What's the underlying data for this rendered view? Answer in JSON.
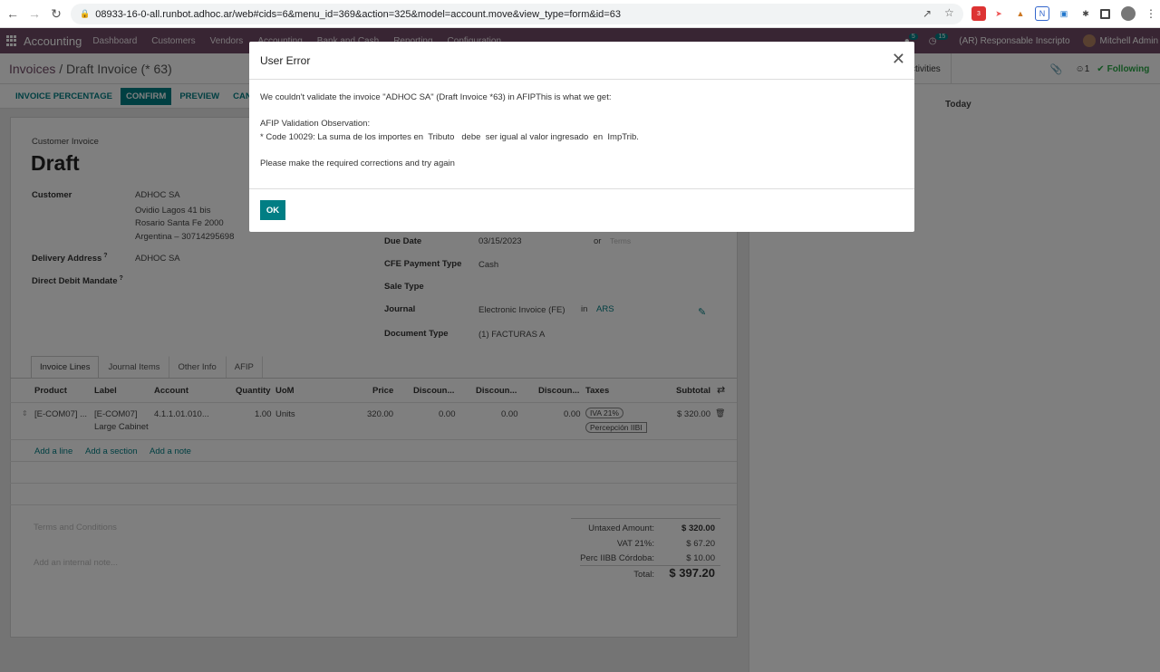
{
  "browser": {
    "url": "08933-16-0-all.runbot.adhoc.ar/web#cids=6&menu_id=369&action=325&model=account.move&view_type=form&id=63",
    "ext_badge": "3"
  },
  "topnav": {
    "app_name": "Accounting",
    "menus": [
      "Dashboard",
      "Customers",
      "Vendors",
      "Accounting",
      "Bank and Cash",
      "Reporting",
      "Configuration"
    ],
    "chat_count": "5",
    "activity_count": "15",
    "company": "(AR) Responsable Inscripto",
    "user": "Mitchell Admin"
  },
  "control": {
    "breadcrumb_parent": "Invoices",
    "breadcrumb_sep": "/",
    "breadcrumb_current": "Draft Invoice (* 63)",
    "activities_label": "ctivities",
    "followers_count": "1",
    "following_label": "Following"
  },
  "buttons": {
    "invoice_percentage": "INVOICE PERCENTAGE",
    "confirm": "CONFIRM",
    "preview": "PREVIEW",
    "cancel": "CANC"
  },
  "chatter": {
    "today": "Today"
  },
  "form": {
    "type_label": "Customer Invoice",
    "status": "Draft",
    "customer_label": "Customer",
    "customer_lines": [
      "ADHOC SA",
      "Ovidio Lagos 41 bis",
      "Rosario Santa Fe 2000",
      "Argentina – 30714295698"
    ],
    "delivery_label": "Delivery Address",
    "delivery_value": "ADHOC SA",
    "debit_label": "Direct Debit Mandate",
    "help_mark": "?",
    "due_date_label": "Due Date",
    "due_date_value": "03/15/2023",
    "or_label": "or",
    "terms_placeholder": "Terms",
    "cfe_label": "CFE Payment Type",
    "cfe_value": "Cash",
    "sale_type_label": "Sale Type",
    "journal_label": "Journal",
    "journal_value": "Electronic Invoice (FE)",
    "in_label": "in",
    "currency": "ARS",
    "doc_type_label": "Document Type",
    "doc_type_value": "(1) FACTURAS A"
  },
  "tabs": [
    "Invoice Lines",
    "Journal Items",
    "Other Info",
    "AFIP"
  ],
  "lines": {
    "headers": [
      "Product",
      "Label",
      "Account",
      "Quantity",
      "UoM",
      "Price",
      "Discoun...",
      "Discoun...",
      "Discoun...",
      "Taxes",
      "Subtotal"
    ],
    "row": {
      "product": "[E-COM07] ...",
      "label1": "[E-COM07]",
      "label2": "Large Cabinet",
      "account": "4.1.1.01.010...",
      "quantity": "1.00",
      "uom": "Units",
      "price": "320.00",
      "disc1": "0.00",
      "disc2": "0.00",
      "disc3": "0.00",
      "tax1": "IVA 21%",
      "tax2": "Percepción IIBI",
      "subtotal": "$ 320.00"
    },
    "add_line": "Add a line",
    "add_section": "Add a section",
    "add_note": "Add a note"
  },
  "footer": {
    "terms_placeholder": "Terms and Conditions",
    "note_placeholder": "Add an internal note...",
    "untaxed_label": "Untaxed Amount:",
    "untaxed_value": "$ 320.00",
    "vat_label": "VAT 21%:",
    "vat_value": "$ 67.20",
    "perc_label": "Perc IIBB Córdoba:",
    "perc_value": "$ 10.00",
    "total_label": "Total:",
    "total_value": "$ 397.20"
  },
  "modal": {
    "title": "User Error",
    "line1": "We couldn't validate the invoice \"ADHOC SA\" (Draft Invoice *63) in AFIPThis is what we get:",
    "line2": "AFIP Validation Observation:",
    "line3": "* Code 10029: La suma de los importes en  Tributo   debe  ser igual al valor ingresado  en  ImpTrib.",
    "line4": "Please make the required corrections and try again",
    "ok": "OK"
  }
}
